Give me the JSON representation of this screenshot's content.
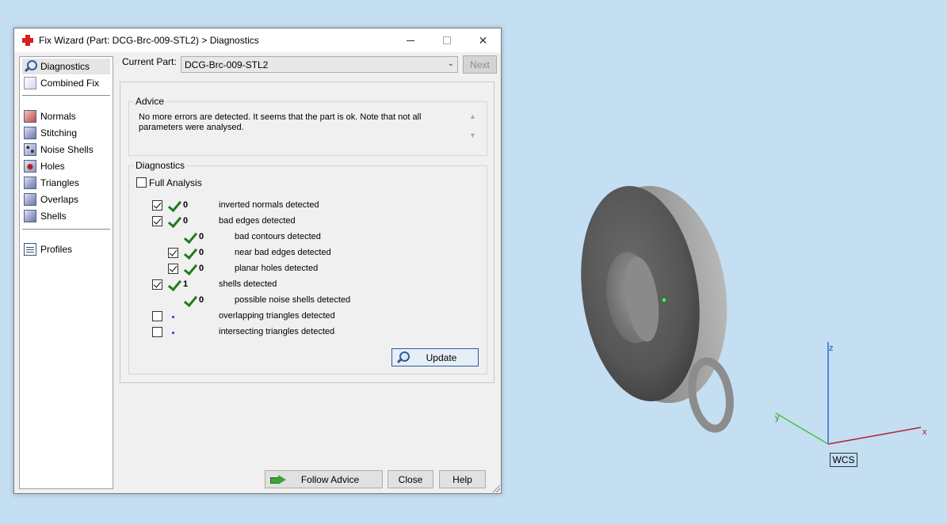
{
  "window": {
    "title": "Fix Wizard (Part: DCG-Brc-009-STL2) > Diagnostics",
    "minimize_glyph": "–",
    "close_glyph": "✕"
  },
  "nav": {
    "items": [
      {
        "label": "Diagnostics",
        "icon": "magnifier-icon"
      },
      {
        "label": "Combined Fix",
        "icon": "combined-fix-icon"
      },
      {
        "label": "Normals",
        "icon": "normals-cube-icon"
      },
      {
        "label": "Stitching",
        "icon": "stitching-cube-icon"
      },
      {
        "label": "Noise Shells",
        "icon": "noise-shells-cube-icon"
      },
      {
        "label": "Holes",
        "icon": "holes-cube-icon"
      },
      {
        "label": "Triangles",
        "icon": "triangles-cube-icon"
      },
      {
        "label": "Overlaps",
        "icon": "overlaps-cube-icon"
      },
      {
        "label": "Shells",
        "icon": "shells-cube-icon"
      },
      {
        "label": "Profiles",
        "icon": "profiles-document-icon"
      }
    ],
    "selected": "Diagnostics"
  },
  "part": {
    "label": "Current Part:",
    "value": "DCG-Brc-009-STL2",
    "next_label": "Next"
  },
  "advice": {
    "legend": "Advice",
    "line1": "No more errors are detected. It seems that the part is ok. Note that not all",
    "line2": "parameters were analysed."
  },
  "diagnostics": {
    "legend": "Diagnostics",
    "full_analysis_label": "Full Analysis",
    "full_analysis_checked": false,
    "rows": [
      {
        "checked": true,
        "status": "ok",
        "count": "0",
        "text": "inverted normals detected"
      },
      {
        "checked": true,
        "status": "ok",
        "count": "0",
        "text": "bad edges detected"
      },
      {
        "checked": null,
        "status": "ok",
        "count": "0",
        "text": "bad contours detected"
      },
      {
        "checked": true,
        "status": "ok",
        "count": "0",
        "text": "near bad edges detected"
      },
      {
        "checked": true,
        "status": "ok",
        "count": "0",
        "text": "planar holes detected"
      },
      {
        "checked": true,
        "status": "ok",
        "count": "1",
        "text": "shells detected"
      },
      {
        "checked": null,
        "status": "ok",
        "count": "0",
        "text": "possible noise shells detected"
      },
      {
        "checked": false,
        "status": "not-run",
        "count": "",
        "text": "overlapping triangles detected"
      },
      {
        "checked": false,
        "status": "not-run",
        "count": "",
        "text": "intersecting triangles detected"
      }
    ],
    "update_label": "Update"
  },
  "footer": {
    "follow_advice": "Follow Advice",
    "close": "Close",
    "help": "Help"
  },
  "viewport": {
    "axis_labels": {
      "z": "z",
      "x": "x",
      "y": "y"
    },
    "wcs_label": "WCS",
    "colors": {
      "background": "#c4def2",
      "x_axis": "#b02030",
      "y_axis": "#4cc23c",
      "z_axis": "#2f6fd0",
      "model": "#7a7a7a"
    }
  }
}
